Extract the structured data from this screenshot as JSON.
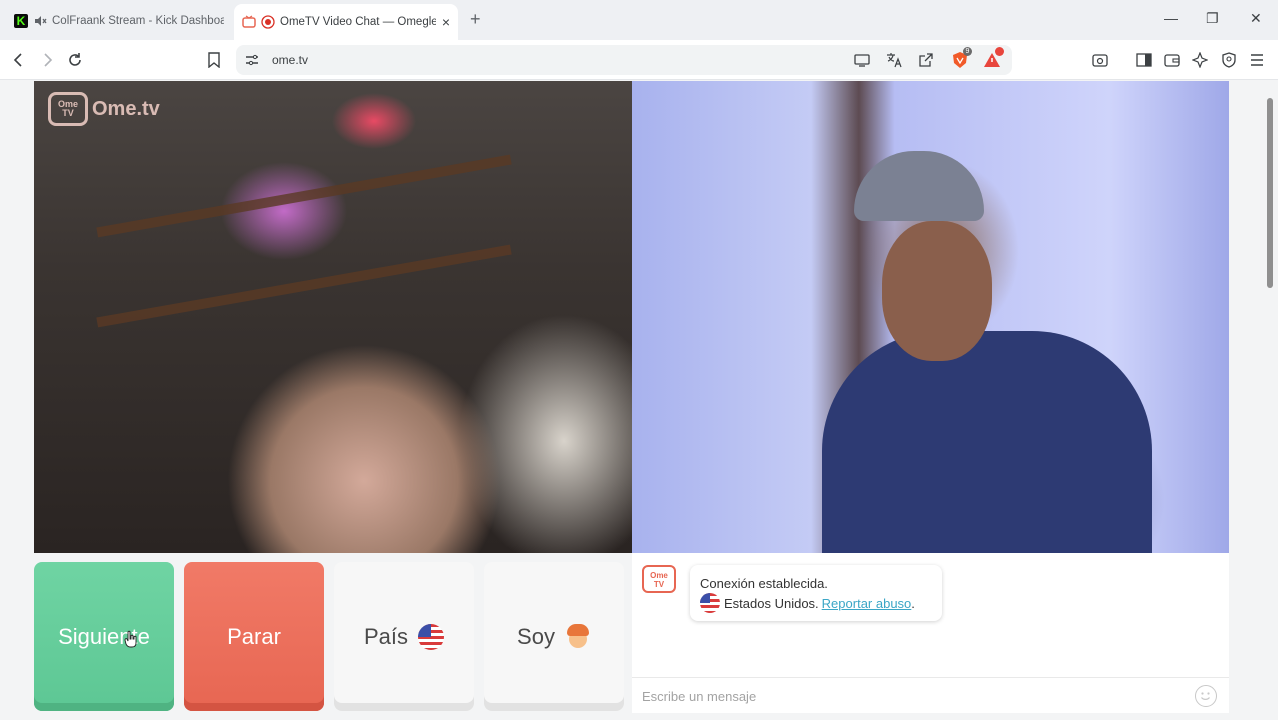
{
  "tabs": [
    {
      "title": "ColFraank Stream - Kick Dashboard",
      "favicon": "kick-icon",
      "favicon_text": "K",
      "active": false
    },
    {
      "title": "OmeTV Video Chat — Omegle",
      "favicon": "ometv-icon",
      "active": true
    }
  ],
  "tab_close_symbol": "×",
  "new_tab_symbol": "+",
  "window_controls": {
    "minimize": "—",
    "restore": "❐",
    "close": "✕"
  },
  "address_bar": {
    "url": "ome.tv"
  },
  "toolbar_badges": {
    "shields_count": "9"
  },
  "brand": {
    "logo_small": "Ome\nTV",
    "name": "Ome.tv"
  },
  "controls": {
    "next_label": "Siguiente",
    "stop_label": "Parar",
    "country_label": "País",
    "gender_label": "Soy"
  },
  "chat": {
    "logo_text": "Ome\nTV",
    "status_message": "Conexión establecida.",
    "location_text": "Estados Unidos.",
    "report_link": "Reportar abuso",
    "report_suffix": ".",
    "input_placeholder": "Escribe un mensaje"
  },
  "colors": {
    "next_button": "#5dc794",
    "stop_button": "#e76652",
    "link": "#3ba6c6",
    "brand_accent": "#e76652"
  }
}
